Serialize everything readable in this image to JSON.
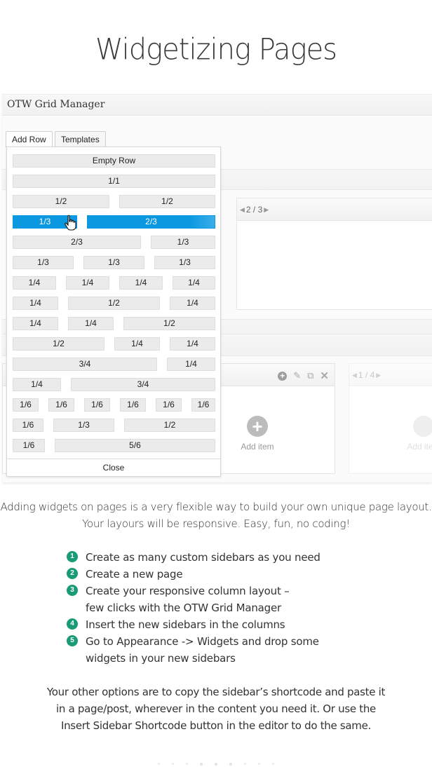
{
  "page": {
    "title": "Widgetizing Pages"
  },
  "screenshot": {
    "panel_title": "OTW Grid Manager",
    "tabs": [
      {
        "label": "Add Row",
        "active": true
      },
      {
        "label": "Templates",
        "active": false
      }
    ],
    "dropdown": {
      "empty_row_label": "Empty Row",
      "layouts": [
        [
          "1/1"
        ],
        [
          "1/2",
          "1/2"
        ],
        [
          "1/3",
          "2/3"
        ],
        [
          "2/3",
          "1/3"
        ],
        [
          "1/3",
          "1/3",
          "1/3"
        ],
        [
          "1/4",
          "1/4",
          "1/4",
          "1/4"
        ],
        [
          "1/4",
          "1/2",
          "1/4"
        ],
        [
          "1/4",
          "1/4",
          "1/2"
        ],
        [
          "1/2",
          "1/4",
          "1/4"
        ],
        [
          "3/4",
          "1/4"
        ],
        [
          "1/4",
          "3/4"
        ],
        [
          "1/6",
          "1/6",
          "1/6",
          "1/6",
          "1/6",
          "1/6"
        ],
        [
          "1/6",
          "1/3",
          "1/2"
        ],
        [
          "1/6",
          "5/6"
        ]
      ],
      "hovered_row_index": 2,
      "close_label": "Close"
    },
    "columns": {
      "top_pager": {
        "current": "2",
        "total": "3",
        "text": "2 / 3"
      },
      "bottom_pager": {
        "current": "1",
        "total": "4",
        "text": "1 / 4"
      },
      "add_item_label": "Add item",
      "tool_icons": [
        "add-icon",
        "edit-icon",
        "duplicate-icon",
        "delete-icon"
      ]
    },
    "accent_color": "#0b98e0"
  },
  "content": {
    "intro": "Adding widgets on pages is a very flexible way to build your own unique page layout. Your layours will be responsive. Easy, fun, no coding!",
    "intro_lines": [
      "Adding widgets on pages is a very flexible way to build your own unique page layout.",
      "Your layours will be responsive. Easy, fun, no coding!"
    ],
    "steps": [
      {
        "num": "1",
        "lines": [
          "Create as many custom sidebars as you need"
        ]
      },
      {
        "num": "2",
        "lines": [
          "Create a new page"
        ]
      },
      {
        "num": "3",
        "lines": [
          "Create your responsive column layout –",
          "few clicks with the OTW Grid Manager"
        ]
      },
      {
        "num": "4",
        "lines": [
          "Insert the new sidebars in the columns"
        ]
      },
      {
        "num": "5",
        "lines": [
          "Go to Appearance -> Widgets and drop some",
          "widgets in your new sidebars"
        ]
      }
    ],
    "step_badge_color": "#1a9b78",
    "outro_lines": [
      "Your other options are to copy the sidebar’s shortcode and paste it",
      "in a page/post, wherever in the content you need it. Or use the",
      "Insert Sidebar Shortcode button in the editor to do the same."
    ]
  },
  "carousel": {
    "dot_count": 9,
    "active_index": 4
  }
}
